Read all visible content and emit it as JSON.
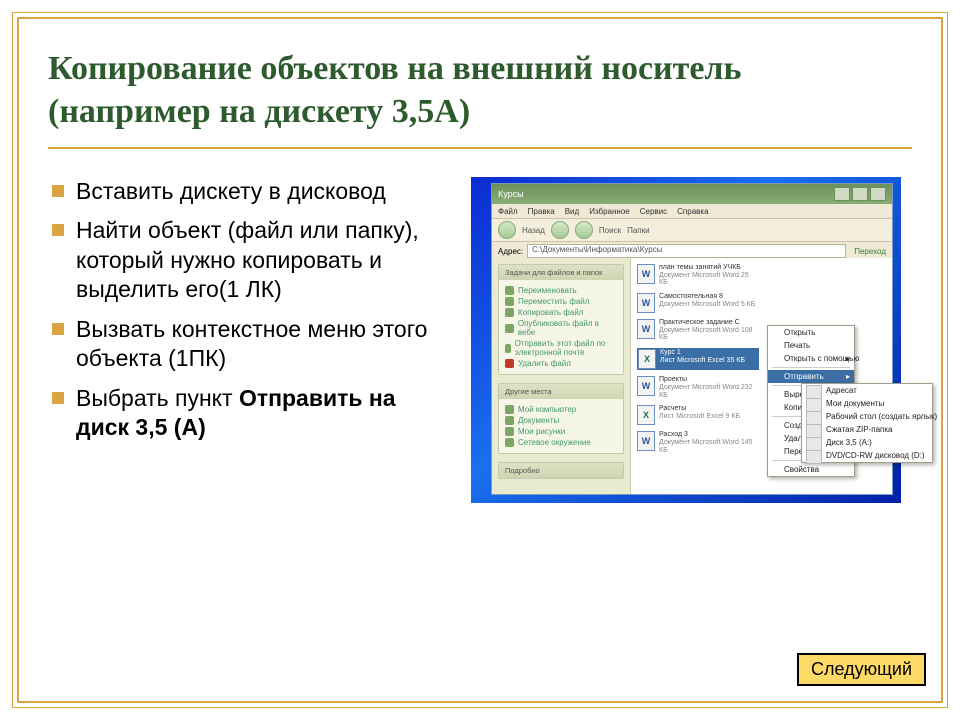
{
  "domain": "Document",
  "slide": {
    "title": "Копирование объектов на внешний носитель (например на дискету 3,5А)",
    "bullets": [
      "Вставить дискету в дисковод",
      "Найти объект (файл или папку), который нужно копировать и выделить его(1 ЛК)",
      "Вызвать контекстное меню этого объекта (1ПК)",
      "Выбрать пункт "
    ],
    "bullet4_bold": "Отправить на диск 3,5 (А)",
    "next_button": "Следующий"
  },
  "screenshot": {
    "window_title": "Курсы",
    "menu_items": [
      "Файл",
      "Правка",
      "Вид",
      "Избранное",
      "Сервис",
      "Справка"
    ],
    "toolbar": {
      "back": "Назад",
      "fwd": "",
      "up": "",
      "search": "Поиск",
      "folders": "Папки"
    },
    "address_label": "Адрес:",
    "address_value": "C:\\Документы\\Информатика\\Курсы",
    "go_label": "Переход",
    "side_panels": {
      "tasks": {
        "header": "Задачи для файлов и папок",
        "items": [
          "Переименовать",
          "Переместить файл",
          "Копировать файл",
          "Опубликовать файл в вебе",
          "Отправить этот файл по электронной почте",
          "Удалить файл"
        ]
      },
      "other": {
        "header": "Другие места",
        "items": [
          "Мой компьютер",
          "Документы",
          "Мои рисунки",
          "Сетевое окружение"
        ]
      },
      "details": {
        "header": "Подробно"
      }
    },
    "files": [
      {
        "icon": "w",
        "name": "план темы занятий УЧКБ",
        "meta": "Документ Microsoft Word\n25 КБ"
      },
      {
        "icon": "w",
        "name": "Самостоятельная 8",
        "meta": "Документ Microsoft Word\n5 КБ"
      },
      {
        "icon": "w",
        "name": "Практическое задание С",
        "meta": "Документ Microsoft Word\n108 КБ"
      },
      {
        "icon": "x",
        "name": "Курс 1",
        "meta": "Лист Microsoft Excel\n35 КБ",
        "selected": true
      },
      {
        "icon": "w",
        "name": "Проекты",
        "meta": "Документ Microsoft Word\n232 КБ"
      },
      {
        "icon": "x",
        "name": "Расчеты",
        "meta": "Лист Microsoft Excel\n9 КБ"
      },
      {
        "icon": "w",
        "name": "Расход 3",
        "meta": "Документ Microsoft Word\n145 КБ"
      }
    ],
    "context_menu": {
      "items": [
        "Открыть",
        "Печать",
        "Открыть с помощью",
        "Отправить",
        "Вырезать",
        "Копировать",
        "Создать ярлык",
        "Удалить",
        "Переименовать",
        "Свойства"
      ],
      "highlighted": "Отправить"
    },
    "submenu": {
      "items": [
        "Адресат",
        "Мои документы",
        "Рабочий стол (создать ярлык)",
        "Сжатая ZIP-папка",
        "Диск 3,5 (A:)",
        "DVD/CD-RW дисковод (D:)"
      ]
    }
  },
  "arrows": {
    "note": "Two red arrows pointing to 'Отправить' and 'Диск 3,5 (A:)'"
  }
}
